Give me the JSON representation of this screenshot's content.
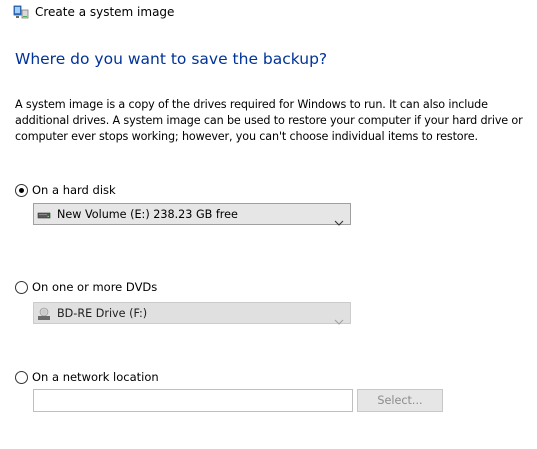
{
  "window": {
    "title": "Create a system image",
    "icon": "system-image-backup-icon"
  },
  "heading": "Where do you want to save the backup?",
  "description": "A system image is a copy of the drives required for Windows to run. It can also include additional drives. A system image can be used to restore your computer if your hard drive or computer ever stops working; however, you can't choose individual items to restore.",
  "options": {
    "hard_disk": {
      "label": "On a hard disk",
      "selected": true,
      "dropdown_value": "New Volume (E:)  238.23 GB free",
      "dropdown_icon": "hard-drive-icon",
      "enabled": true
    },
    "dvd": {
      "label": "On one or more DVDs",
      "selected": false,
      "dropdown_value": "BD-RE Drive (F:)",
      "dropdown_icon": "optical-drive-icon",
      "enabled": false
    },
    "network": {
      "label": "On a network location",
      "selected": false,
      "input_value": "",
      "select_button_label": "Select...",
      "enabled": false
    }
  },
  "colors": {
    "heading": "#003399",
    "disabled_text": "#8c8c8c"
  }
}
